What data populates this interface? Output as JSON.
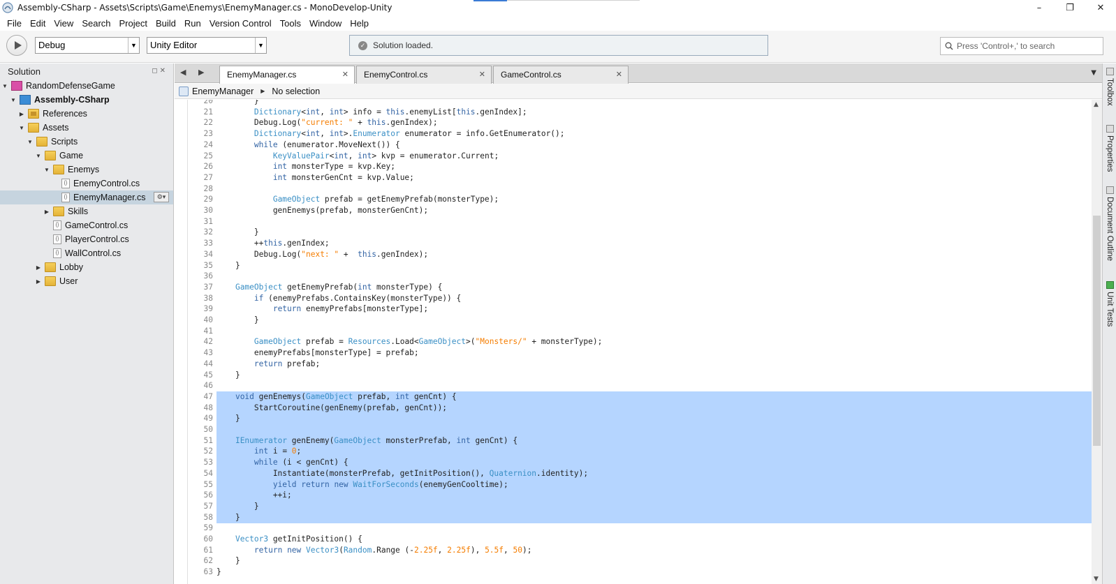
{
  "window": {
    "title": "Assembly-CSharp - Assets\\Scripts\\Game\\Enemys\\EnemyManager.cs - MonoDevelop-Unity",
    "controls": [
      "–",
      "❐",
      "✕"
    ]
  },
  "menu": [
    "File",
    "Edit",
    "View",
    "Search",
    "Project",
    "Build",
    "Run",
    "Version Control",
    "Tools",
    "Window",
    "Help"
  ],
  "toolbar": {
    "config": "Debug",
    "target": "Unity Editor",
    "status": "Solution loaded.",
    "search_placeholder": "Press 'Control+,' to search"
  },
  "solution": {
    "title": "Solution",
    "items": [
      {
        "label": "RandomDefenseGame",
        "level": 0,
        "expanded": true,
        "icon": "solution-icon"
      },
      {
        "label": "Assembly-CSharp",
        "level": 1,
        "expanded": true,
        "icon": "project-icon",
        "bold": true
      },
      {
        "label": "References",
        "level": 2,
        "expanded": false,
        "icon": "references-icon"
      },
      {
        "label": "Assets",
        "level": 2,
        "expanded": true,
        "icon": "folder-icon"
      },
      {
        "label": "Scripts",
        "level": 3,
        "expanded": true,
        "icon": "folder-icon"
      },
      {
        "label": "Game",
        "level": 4,
        "expanded": true,
        "icon": "folder-icon"
      },
      {
        "label": "Enemys",
        "level": 5,
        "expanded": true,
        "icon": "folder-icon"
      },
      {
        "label": "EnemyControl.cs",
        "level": 6,
        "icon": "cs-file-icon"
      },
      {
        "label": "EnemyManager.cs",
        "level": 6,
        "icon": "cs-file-icon",
        "selected": true
      },
      {
        "label": "Skills",
        "level": 5,
        "expanded": false,
        "icon": "folder-icon"
      },
      {
        "label": "GameControl.cs",
        "level": 5,
        "icon": "cs-file-icon"
      },
      {
        "label": "PlayerControl.cs",
        "level": 5,
        "icon": "cs-file-icon"
      },
      {
        "label": "WallControl.cs",
        "level": 5,
        "icon": "cs-file-icon"
      },
      {
        "label": "Lobby",
        "level": 4,
        "expanded": false,
        "icon": "folder-icon"
      },
      {
        "label": "User",
        "level": 4,
        "expanded": false,
        "icon": "folder-icon"
      }
    ]
  },
  "tabs": [
    {
      "label": "EnemyManager.cs",
      "active": true
    },
    {
      "label": "EnemyControl.cs",
      "active": false
    },
    {
      "label": "GameControl.cs",
      "active": false
    }
  ],
  "breadcrumb": {
    "class_name": "EnemyManager",
    "member": "No selection"
  },
  "code": {
    "first_line": 20,
    "highlight_from": 47,
    "highlight_to": 58,
    "lines": [
      "        }",
      "        Dictionary<int, int> info = this.enemyList[this.genIndex];",
      "        Debug.Log(\"current: \" + this.genIndex);",
      "        Dictionary<int, int>.Enumerator enumerator = info.GetEnumerator();",
      "        while (enumerator.MoveNext()) {",
      "            KeyValuePair<int, int> kvp = enumerator.Current;",
      "            int monsterType = kvp.Key;",
      "            int monsterGenCnt = kvp.Value;",
      "",
      "            GameObject prefab = getEnemyPrefab(monsterType);",
      "            genEnemys(prefab, monsterGenCnt);",
      "",
      "        }",
      "        ++this.genIndex;",
      "        Debug.Log(\"next: \" +  this.genIndex);",
      "    }",
      "",
      "    GameObject getEnemyPrefab(int monsterType) {",
      "        if (enemyPrefabs.ContainsKey(monsterType)) {",
      "            return enemyPrefabs[monsterType];",
      "        }",
      "",
      "        GameObject prefab = Resources.Load<GameObject>(\"Monsters/\" + monsterType);",
      "        enemyPrefabs[monsterType] = prefab;",
      "        return prefab;",
      "    }",
      "",
      "    void genEnemys(GameObject prefab, int genCnt) {",
      "        StartCoroutine(genEnemy(prefab, genCnt));",
      "    }",
      "",
      "    IEnumerator genEnemy(GameObject monsterPrefab, int genCnt) {",
      "        int i = 0;",
      "        while (i < genCnt) {",
      "            Instantiate(monsterPrefab, getInitPosition(), Quaternion.identity);",
      "            yield return new WaitForSeconds(enemyGenCooltime);",
      "            ++i;",
      "        }",
      "    }",
      "",
      "    Vector3 getInitPosition() {",
      "        return new Vector3(Random.Range (-2.25f, 2.25f), 5.5f, 50);",
      "    }",
      "}"
    ]
  },
  "right_dock": [
    "Toolbox",
    "Properties",
    "Document Outline",
    "Unit Tests"
  ],
  "colors": {
    "keyword": "#3364a4",
    "type": "#3a8fc5",
    "string": "#f57d00",
    "selection": "#b5d5ff"
  }
}
